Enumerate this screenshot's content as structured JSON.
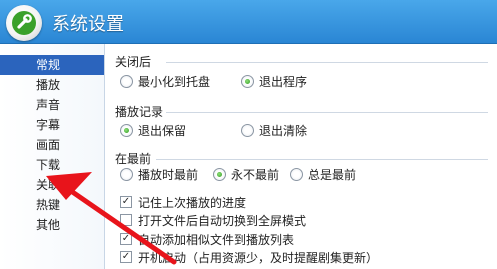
{
  "window": {
    "title": "系统设置"
  },
  "sidebar": {
    "items": [
      {
        "label": "常规",
        "active": true
      },
      {
        "label": "播放"
      },
      {
        "label": "声音"
      },
      {
        "label": "字幕"
      },
      {
        "label": "画面"
      },
      {
        "label": "下载"
      },
      {
        "label": "关联"
      },
      {
        "label": "热键"
      },
      {
        "label": "其他"
      }
    ]
  },
  "sections": {
    "on_close": {
      "title": "关闭后",
      "options": [
        {
          "label": "最小化到托盘",
          "selected": false
        },
        {
          "label": "退出程序",
          "selected": true
        }
      ]
    },
    "history": {
      "title": "播放记录",
      "options": [
        {
          "label": "退出保留",
          "selected": true
        },
        {
          "label": "退出清除",
          "selected": false
        }
      ]
    },
    "on_top": {
      "title": "在最前",
      "options": [
        {
          "label": "播放时最前",
          "selected": false
        },
        {
          "label": "永不最前",
          "selected": true
        },
        {
          "label": "总是最前",
          "selected": false
        }
      ]
    }
  },
  "checkboxes": [
    {
      "label": "记住上次播放的进度",
      "checked": true
    },
    {
      "label": "打开文件后自动切换到全屏模式",
      "checked": false
    },
    {
      "label": "自动添加相似文件到播放列表",
      "checked": true
    },
    {
      "label": "开机启动（占用资源少，及时提醒剧集更新）",
      "checked": true
    }
  ],
  "check_mark": "✓",
  "colors": {
    "titlebar": "#2a86d4",
    "sidebar_active": "#2b64bd",
    "annotation_arrow": "#e8141b",
    "radio_selected": "#2d9a1f"
  }
}
